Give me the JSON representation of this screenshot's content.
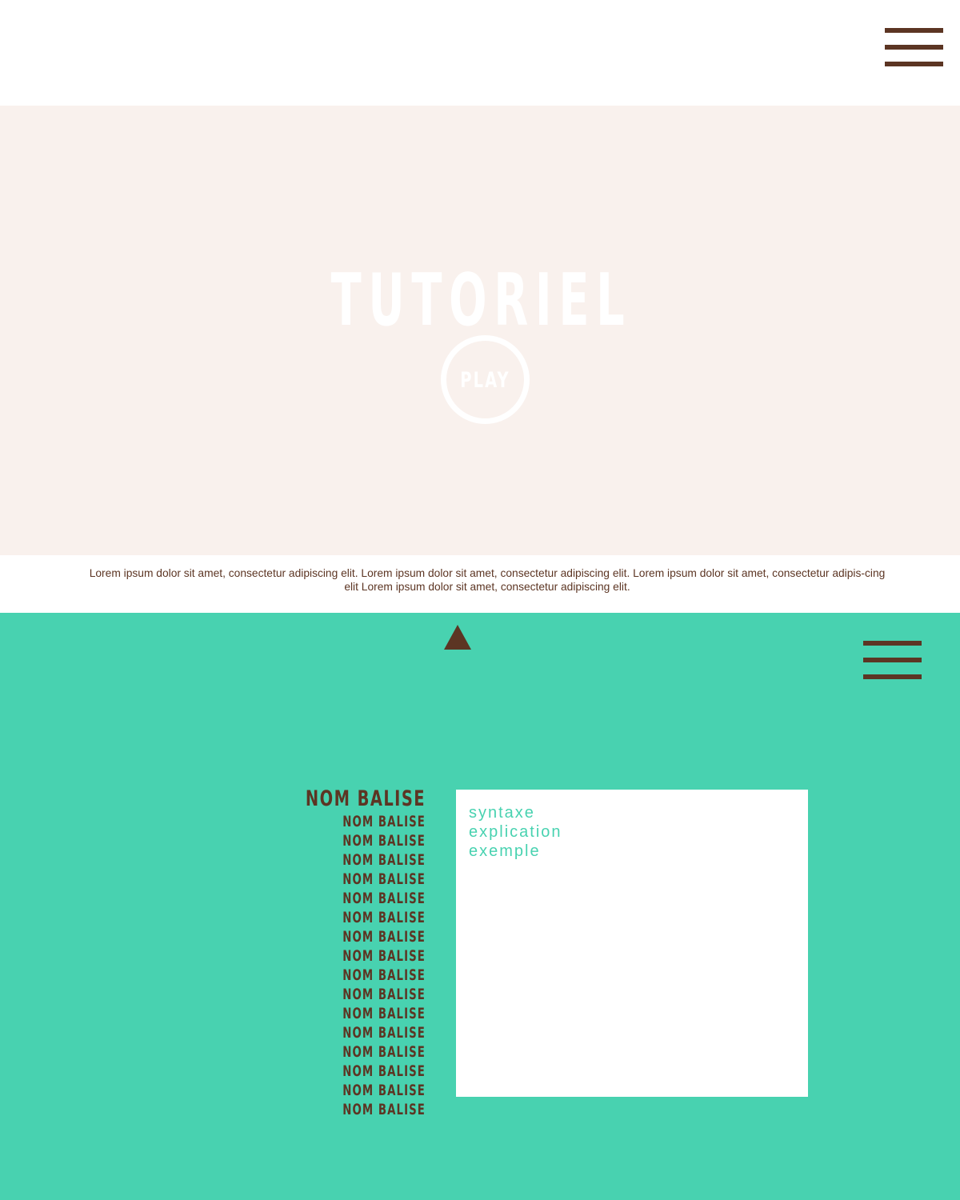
{
  "colors": {
    "accent": "#48d2b0",
    "brown": "#5c3523",
    "hero_bg": "#f9f1ed",
    "white": "#ffffff"
  },
  "header": {
    "menu_icon": "hamburger-menu-icon"
  },
  "hero": {
    "title": "TUTORIEL",
    "play_label": "PLAY"
  },
  "intro": {
    "text": "Lorem ipsum dolor sit amet, consectetur adipiscing elit. Lorem ipsum dolor sit amet, consectetur adipiscing elit. Lorem ipsum dolor sit amet, consectetur adipis-cing elit Lorem ipsum dolor sit amet, consectetur adipiscing elit."
  },
  "tags_section": {
    "up_icon": "triangle-up-icon",
    "menu_icon": "hamburger-menu-icon",
    "tags": [
      "NOM BALISE",
      "NOM BALISE",
      "NOM BALISE",
      "NOM BALISE",
      "NOM BALISE",
      "NOM BALISE",
      "NOM BALISE",
      "NOM BALISE",
      "NOM BALISE",
      "NOM BALISE",
      "NOM BALISE",
      "NOM BALISE",
      "NOM BALISE",
      "NOM BALISE",
      "NOM BALISE",
      "NOM BALISE",
      "NOM BALISE"
    ],
    "selected_index": 0,
    "detail": {
      "line1": "syntaxe",
      "line2": "explication",
      "line3": "exemple"
    }
  }
}
